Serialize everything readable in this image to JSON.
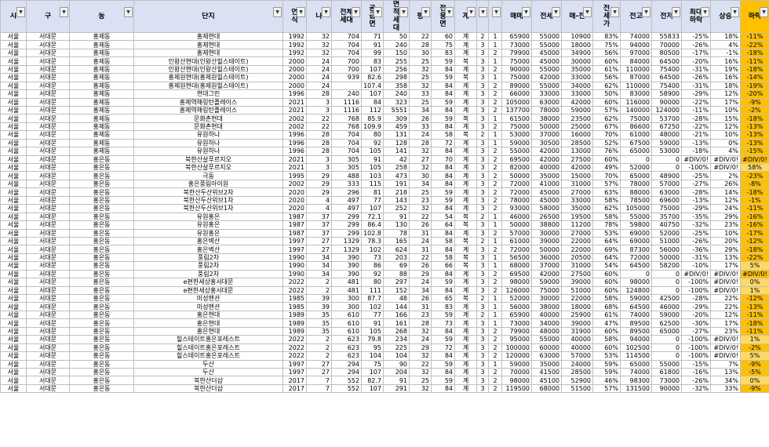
{
  "headers": [
    "시",
    "구",
    "동",
    "단지",
    "연식",
    "나",
    "전체세대",
    "공급면",
    "면적세대",
    "평",
    "전용면",
    "계",
    "",
    "",
    "매매",
    "전세",
    "매-전",
    "전세가",
    "전고",
    "전저",
    "최대하락",
    "상승",
    "하락"
  ],
  "rows": [
    [
      "서울",
      "서대문",
      "홍제동",
      "홍제현대",
      "1992",
      "32",
      "704",
      "71",
      "50",
      "22",
      "60",
      "계",
      "2",
      "1",
      "65900",
      "55000",
      "10900",
      "83%",
      "74000",
      "55833",
      "-25%",
      "18%",
      "-11%"
    ],
    [
      "서울",
      "서대문",
      "홍제동",
      "홍제현대",
      "1992",
      "32",
      "704",
      "91",
      "240",
      "28",
      "75",
      "계",
      "3",
      "1",
      "73000",
      "55000",
      "18000",
      "75%",
      "94000",
      "70000",
      "-26%",
      "4%",
      "-22%"
    ],
    [
      "서울",
      "서대문",
      "홍제동",
      "홍제현대",
      "1992",
      "32",
      "704",
      "99",
      "150",
      "30",
      "83",
      "계",
      "3",
      "2",
      "79900",
      "45000",
      "34900",
      "56%",
      "97000",
      "80500",
      "-17%",
      "-1%",
      "-18%"
    ],
    [
      "서울",
      "서대문",
      "홍제동",
      "인왕산현대(인왕산힐스테이트)",
      "2000",
      "24",
      "700",
      "83",
      "255",
      "25",
      "59",
      "복",
      "3",
      "1",
      "75000",
      "45000",
      "30000",
      "60%",
      "84000",
      "64500",
      "-20%",
      "16%",
      "-11%"
    ],
    [
      "서울",
      "서대문",
      "홍제동",
      "인왕산현대(인왕산힐스테이트)",
      "2000",
      "24",
      "700",
      "107",
      "256",
      "32",
      "84",
      "계",
      "3",
      "2",
      "90000",
      "55000",
      "35000",
      "61%",
      "110000",
      "75400",
      "-31%",
      "19%",
      "-18%"
    ],
    [
      "서울",
      "서대문",
      "홍제동",
      "홍제원현대(홍제원힐스테이트)",
      "2000",
      "24",
      "939",
      "82.6",
      "298",
      "25",
      "59",
      "복",
      "3",
      "1",
      "75000",
      "42000",
      "33000",
      "56%",
      "87000",
      "64500",
      "-26%",
      "16%",
      "-14%"
    ],
    [
      "서울",
      "서대문",
      "홍제동",
      "홍제원현대(홍제원힐스테이트)",
      "2000",
      "24",
      "",
      "107.4",
      "358",
      "32",
      "84",
      "계",
      "3",
      "2",
      "89000",
      "55000",
      "34000",
      "62%",
      "110000",
      "75400",
      "-31%",
      "18%",
      "-19%"
    ],
    [
      "서울",
      "서대문",
      "홍제동",
      "현대그린",
      "1996",
      "28",
      "240",
      "107",
      "240",
      "33",
      "84",
      "계",
      "3",
      "2",
      "66000",
      "33000",
      "33000",
      "50%",
      "83000",
      "58900",
      "-29%",
      "12%",
      "-20%"
    ],
    [
      "서울",
      "서대문",
      "홍제동",
      "홍제역해링턴플레이스",
      "2021",
      "3",
      "1116",
      "84",
      "323",
      "25",
      "59",
      "계",
      "3",
      "2",
      "105000",
      "63000",
      "42000",
      "60%",
      "116000",
      "90000",
      "-22%",
      "17%",
      "-9%"
    ],
    [
      "서울",
      "서대문",
      "홍제동",
      "홍제역해링턴플레이스",
      "2021",
      "3",
      "1116",
      "112",
      "5551",
      "34",
      "84",
      "계",
      "3",
      "2",
      "137700",
      "78000",
      "59000",
      "57%",
      "140000",
      "124000",
      "-11%",
      "10%",
      "-2%"
    ],
    [
      "서울",
      "서대문",
      "홍제동",
      "문화촌현대",
      "2002",
      "22",
      "768",
      "85.9",
      "309",
      "26",
      "59",
      "복",
      "3",
      "1",
      "61500",
      "38000",
      "23500",
      "62%",
      "75000",
      "53700",
      "-28%",
      "15%",
      "-18%"
    ],
    [
      "서울",
      "서대문",
      "홍제동",
      "문화촌현대",
      "2002",
      "22",
      "768",
      "109.9",
      "459",
      "33",
      "84",
      "계",
      "3",
      "2",
      "75000",
      "50000",
      "25000",
      "67%",
      "86600",
      "67250",
      "-22%",
      "12%",
      "-13%"
    ],
    [
      "서울",
      "서대문",
      "홍제동",
      "유원하나",
      "1996",
      "28",
      "704",
      "80",
      "131",
      "24",
      "58",
      "복",
      "2",
      "1",
      "53000",
      "37000",
      "16000",
      "70%",
      "61000",
      "48000",
      "-21%",
      "10%",
      "-13%"
    ],
    [
      "서울",
      "서대문",
      "홍제동",
      "유원하나",
      "1996",
      "28",
      "704",
      "92",
      "128",
      "28",
      "72",
      "계",
      "3",
      "1",
      "59000",
      "30500",
      "28500",
      "52%",
      "67500",
      "59000",
      "-13%",
      "0%",
      "-13%"
    ],
    [
      "서울",
      "서대문",
      "홍제동",
      "유원하나",
      "1996",
      "28",
      "704",
      "105",
      "141",
      "32",
      "84",
      "계",
      "3",
      "2",
      "55000",
      "42000",
      "13000",
      "76%",
      "65000",
      "53000",
      "-18%",
      "4%",
      "-15%"
    ],
    [
      "서울",
      "서대문",
      "홍은동",
      "북한산살푸르지오",
      "2021",
      "3",
      "305",
      "91",
      "42",
      "27",
      "70",
      "계",
      "3",
      "2",
      "69500",
      "42000",
      "27500",
      "60%",
      "0",
      "0",
      "#DIV/0!",
      "#DIV/0!",
      "#DIV/0!"
    ],
    [
      "서울",
      "서대문",
      "홍은동",
      "북한산살푸르지오",
      "2021",
      "3",
      "305",
      "105",
      "258",
      "32",
      "84",
      "계",
      "3",
      "2",
      "82000",
      "40000",
      "42000",
      "49%",
      "52000",
      "0",
      "-100%",
      "#DIV/0!",
      "58%"
    ],
    [
      "서울",
      "서대문",
      "홍은동",
      "극동",
      "1995",
      "29",
      "488",
      "103",
      "473",
      "30",
      "84",
      "계",
      "3",
      "2",
      "50000",
      "35000",
      "15000",
      "70%",
      "65000",
      "48900",
      "-25%",
      "2%",
      "-23%"
    ],
    [
      "서울",
      "서대문",
      "홍은동",
      "홍은풍림아이원",
      "2002",
      "29",
      "333",
      "115",
      "191",
      "34",
      "84",
      "계",
      "3",
      "2",
      "72000",
      "41000",
      "31000",
      "57%",
      "78000",
      "57000",
      "-27%",
      "26%",
      "-8%"
    ],
    [
      "서울",
      "서대문",
      "홍은동",
      "북한산두산위브2차",
      "2020",
      "29",
      "296",
      "81",
      "218",
      "25",
      "59",
      "계",
      "3",
      "2",
      "72000",
      "45000",
      "27000",
      "63%",
      "88000",
      "63000",
      "-28%",
      "14%",
      "-18%"
    ],
    [
      "서울",
      "서대문",
      "홍은동",
      "북한산두산위브1차",
      "2020",
      "4",
      "497",
      "77",
      "143",
      "23",
      "59",
      "계",
      "3",
      "2",
      "78000",
      "45000",
      "33000",
      "58%",
      "78500",
      "69600",
      "-13%",
      "12%",
      "-1%"
    ],
    [
      "서울",
      "서대문",
      "홍은동",
      "북한산두산위브1차",
      "2020",
      "4",
      "497",
      "107",
      "252",
      "32",
      "84",
      "계",
      "3",
      "2",
      "93000",
      "58000",
      "35000",
      "62%",
      "105000",
      "75000",
      "-29%",
      "24%",
      "-11%"
    ],
    [
      "서울",
      "서대문",
      "홍은동",
      "유원홍은",
      "1987",
      "37",
      "299",
      "72.1",
      "91",
      "22",
      "54",
      "복",
      "2",
      "1",
      "46000",
      "26500",
      "19500",
      "58%",
      "55000",
      "35700",
      "-35%",
      "29%",
      "-16%"
    ],
    [
      "서울",
      "서대문",
      "홍은동",
      "유원홍은",
      "1987",
      "37",
      "299",
      "86.4",
      "130",
      "26",
      "64",
      "복",
      "3",
      "1",
      "50000",
      "38800",
      "11200",
      "78%",
      "59800",
      "40750",
      "-32%",
      "23%",
      "-16%"
    ],
    [
      "서울",
      "서대문",
      "홍은동",
      "유원홍은",
      "1987",
      "37",
      "299",
      "102.8",
      "78",
      "31",
      "84",
      "계",
      "3",
      "2",
      "57000",
      "30000",
      "27000",
      "53%",
      "69000",
      "52000",
      "-25%",
      "10%",
      "-17%"
    ],
    [
      "서울",
      "서대문",
      "홍은동",
      "홍은벽산",
      "1997",
      "27",
      "1329",
      "78.3",
      "165",
      "24",
      "58",
      "복",
      "2",
      "1",
      "61000",
      "39000",
      "22000",
      "64%",
      "69000",
      "51000",
      "-26%",
      "20%",
      "-12%"
    ],
    [
      "서울",
      "서대문",
      "홍은동",
      "홍은벽산",
      "1997",
      "27",
      "1329",
      "102",
      "624",
      "31",
      "84",
      "계",
      "3",
      "2",
      "72000",
      "50000",
      "22000",
      "69%",
      "87300",
      "56000",
      "-36%",
      "29%",
      "-18%"
    ],
    [
      "서울",
      "서대문",
      "홍은동",
      "풍림2차",
      "1990",
      "34",
      "390",
      "73",
      "203",
      "22",
      "58",
      "복",
      "3",
      "1",
      "56500",
      "36000",
      "20500",
      "64%",
      "72000",
      "50000",
      "-31%",
      "13%",
      "-22%"
    ],
    [
      "서울",
      "서대문",
      "홍은동",
      "풍림2차",
      "1990",
      "34",
      "390",
      "86",
      "69",
      "26",
      "66",
      "복",
      "3",
      "1",
      "68000",
      "37000",
      "31000",
      "54%",
      "64500",
      "58200",
      "-10%",
      "17%",
      "5%"
    ],
    [
      "서울",
      "서대문",
      "홍은동",
      "풍림2차",
      "1990",
      "34",
      "390",
      "92",
      "88",
      "29",
      "84",
      "계",
      "3",
      "2",
      "69500",
      "42000",
      "27500",
      "60%",
      "0",
      "0",
      "#DIV/0!",
      "#DIV/0!",
      "#DIV/0!"
    ],
    [
      "서울",
      "서대문",
      "홍은동",
      "e편한세상홍서대문",
      "2022",
      "2",
      "481",
      "80",
      "297",
      "24",
      "59",
      "계",
      "3",
      "2",
      "98000",
      "59000",
      "39000",
      "60%",
      "98000",
      "0",
      "-100%",
      "#DIV/0!",
      "0%"
    ],
    [
      "서울",
      "서대문",
      "홍은동",
      "e편한세상홍서대문",
      "2022",
      "2",
      "481",
      "111",
      "152",
      "34",
      "84",
      "계",
      "3",
      "2",
      "126000",
      "75000",
      "51000",
      "60%",
      "124800",
      "0",
      "-100%",
      "#DIV/0!",
      "1%"
    ],
    [
      "서울",
      "서대문",
      "홍은동",
      "미성맨션",
      "1985",
      "39",
      "300",
      "87.7",
      "48",
      "26",
      "65",
      "복",
      "2",
      "1",
      "52000",
      "30000",
      "22000",
      "58%",
      "59000",
      "42500",
      "-28%",
      "22%",
      "-12%"
    ],
    [
      "서울",
      "서대문",
      "홍은동",
      "미성맨션",
      "1985",
      "39",
      "300",
      "102",
      "144",
      "31",
      "83",
      "계",
      "3",
      "1",
      "56000",
      "38000",
      "18000",
      "68%",
      "64500",
      "46000",
      "-29%",
      "22%",
      "-13%"
    ],
    [
      "서울",
      "서대문",
      "홍은동",
      "홍은현대",
      "1989",
      "35",
      "610",
      "77",
      "166",
      "23",
      "59",
      "계",
      "2",
      "1",
      "65900",
      "40000",
      "25900",
      "61%",
      "74000",
      "59000",
      "-20%",
      "12%",
      "-11%"
    ],
    [
      "서울",
      "서대문",
      "홍은동",
      "홍은현대",
      "1989",
      "35",
      "610",
      "91",
      "161",
      "28",
      "73",
      "계",
      "3",
      "1",
      "73000",
      "34000",
      "39000",
      "47%",
      "89500",
      "62500",
      "-30%",
      "17%",
      "-18%"
    ],
    [
      "서울",
      "서대문",
      "홍은동",
      "홍은현대",
      "1989",
      "35",
      "610",
      "105",
      "268",
      "32",
      "84",
      "계",
      "3",
      "2",
      "79900",
      "48000",
      "31900",
      "60%",
      "89500",
      "65000",
      "-27%",
      "23%",
      "-11%"
    ],
    [
      "서울",
      "서대문",
      "홍은동",
      "힐스테이트홍은포레스트",
      "2022",
      "2",
      "623",
      "79.8",
      "234",
      "24",
      "59",
      "계",
      "3",
      "2",
      "95000",
      "55000",
      "40000",
      "58%",
      "94000",
      "0",
      "-100%",
      "#DIV/0!",
      "1%"
    ],
    [
      "서울",
      "서대문",
      "홍은동",
      "힐스테이트홍은포레스트",
      "2022",
      "2",
      "623",
      "95",
      "225",
      "29",
      "72",
      "계",
      "3",
      "2",
      "100000",
      "60000",
      "40000",
      "60%",
      "102500",
      "0",
      "-100%",
      "#DIV/0!",
      "-2%"
    ],
    [
      "서울",
      "서대문",
      "홍은동",
      "힐스테이트홍은포레스트",
      "2022",
      "2",
      "623",
      "104",
      "104",
      "32",
      "84",
      "계",
      "3",
      "2",
      "120000",
      "63000",
      "57000",
      "53%",
      "114500",
      "0",
      "-100%",
      "#DIV/0!",
      "5%"
    ],
    [
      "서울",
      "서대문",
      "홍은동",
      "두산",
      "1997",
      "27",
      "294",
      "75",
      "90",
      "22",
      "59",
      "계",
      "3",
      "1",
      "59000",
      "35000",
      "24000",
      "59%",
      "65000",
      "55000",
      "-15%",
      "7%",
      "-9%"
    ],
    [
      "서울",
      "서대문",
      "홍은동",
      "두산",
      "1997",
      "27",
      "294",
      "107",
      "204",
      "32",
      "84",
      "계",
      "3",
      "2",
      "70000",
      "41500",
      "28500",
      "59%",
      "74000",
      "61800",
      "-16%",
      "13%",
      "-5%"
    ],
    [
      "서울",
      "서대문",
      "홍은동",
      "북한산더샵",
      "2017",
      "7",
      "552",
      "82.7",
      "91",
      "25",
      "59",
      "계",
      "3",
      "2",
      "98000",
      "45100",
      "52900",
      "46%",
      "98300",
      "73000",
      "-26%",
      "34%",
      "0%"
    ],
    [
      "서울",
      "서대문",
      "홍은동",
      "북한산더샵",
      "2017",
      "7",
      "552",
      "107",
      "291",
      "32",
      "84",
      "계",
      "3",
      "2",
      "119500",
      "68000",
      "51500",
      "57%",
      "131500",
      "90000",
      "-32%",
      "33%",
      "-9%"
    ]
  ]
}
